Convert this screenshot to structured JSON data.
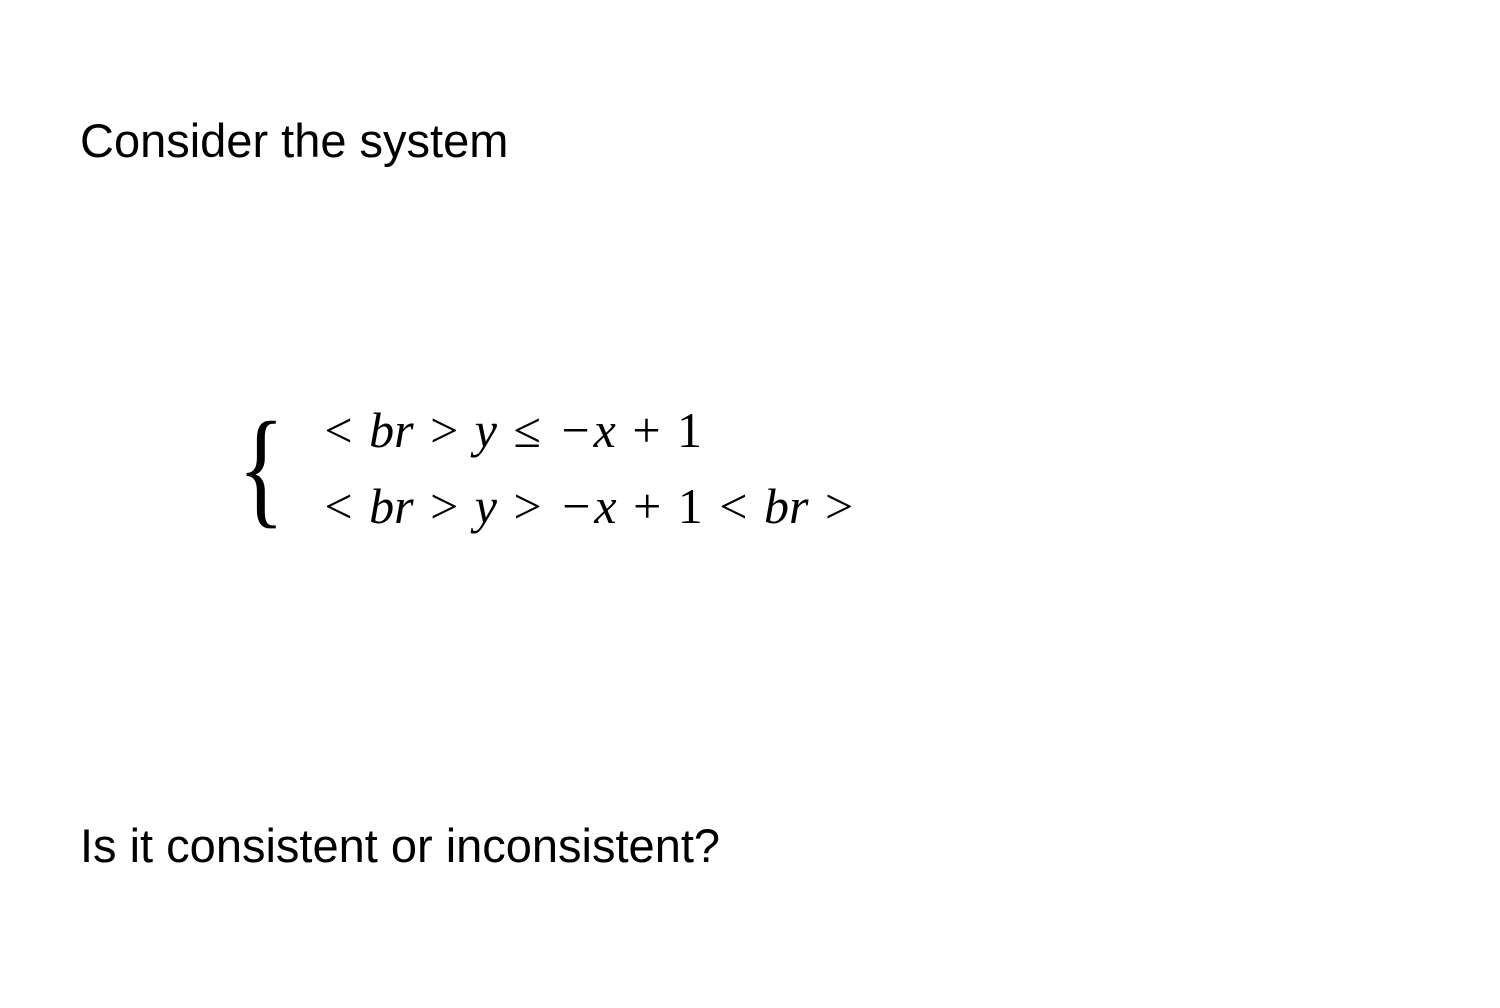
{
  "intro": "Consider the system",
  "math": {
    "line1": {
      "lt1": "<",
      "br1": "br",
      "gt1": ">",
      "y": "y",
      "leq": "≤",
      "minus": "−",
      "x": "x",
      "plus": "+",
      "one": "1"
    },
    "line2": {
      "lt1": "<",
      "br1": "br",
      "gt1": ">",
      "y": "y",
      "gt2": ">",
      "minus": "−",
      "x": "x",
      "plus": "+",
      "one": "1",
      "lt2": "<",
      "br2": "br",
      "gt3": ">"
    }
  },
  "question": "Is it consistent or inconsistent?"
}
